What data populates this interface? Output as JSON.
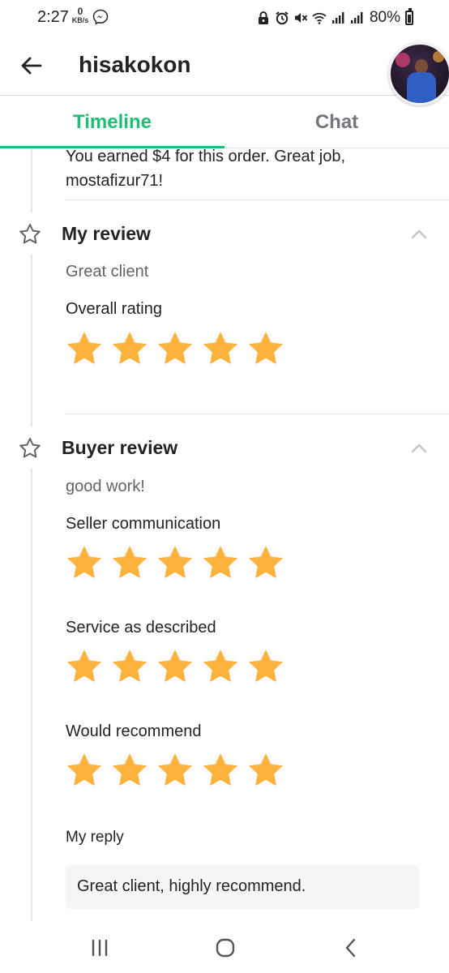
{
  "status_bar": {
    "time": "2:27",
    "net_speed_value": "0",
    "net_speed_unit": "KB/s",
    "battery": "80%",
    "icons": [
      "messenger-icon",
      "lock-icon",
      "alarm-icon",
      "mute-icon",
      "wifi-icon",
      "signal-icon",
      "signal-icon",
      "battery-icon"
    ]
  },
  "header": {
    "title": "hisakokon",
    "back_icon": "arrow-left-icon",
    "avatar": "user-avatar"
  },
  "tabs": [
    {
      "label": "Timeline",
      "active": true
    },
    {
      "label": "Chat",
      "active": false
    }
  ],
  "colors": {
    "accent": "#1dbf73",
    "star": "#ffb33e",
    "text": "#222325",
    "muted": "#62646a"
  },
  "timeline": {
    "earned_message": "You earned $4 for this order. Great job, mostafizur71!",
    "my_review": {
      "title": "My review",
      "comment": "Great client",
      "rating_label": "Overall rating",
      "rating": 5
    },
    "buyer_review": {
      "title": "Buyer review",
      "comment": "good work!",
      "ratings": [
        {
          "label": "Seller communication",
          "rating": 5
        },
        {
          "label": "Service as described",
          "rating": 5
        },
        {
          "label": "Would recommend",
          "rating": 5
        }
      ],
      "reply_label": "My reply",
      "reply_text": "Great client, highly recommend."
    }
  },
  "nav_bar": {
    "buttons": [
      "recents-icon",
      "home-icon",
      "back-icon"
    ]
  }
}
